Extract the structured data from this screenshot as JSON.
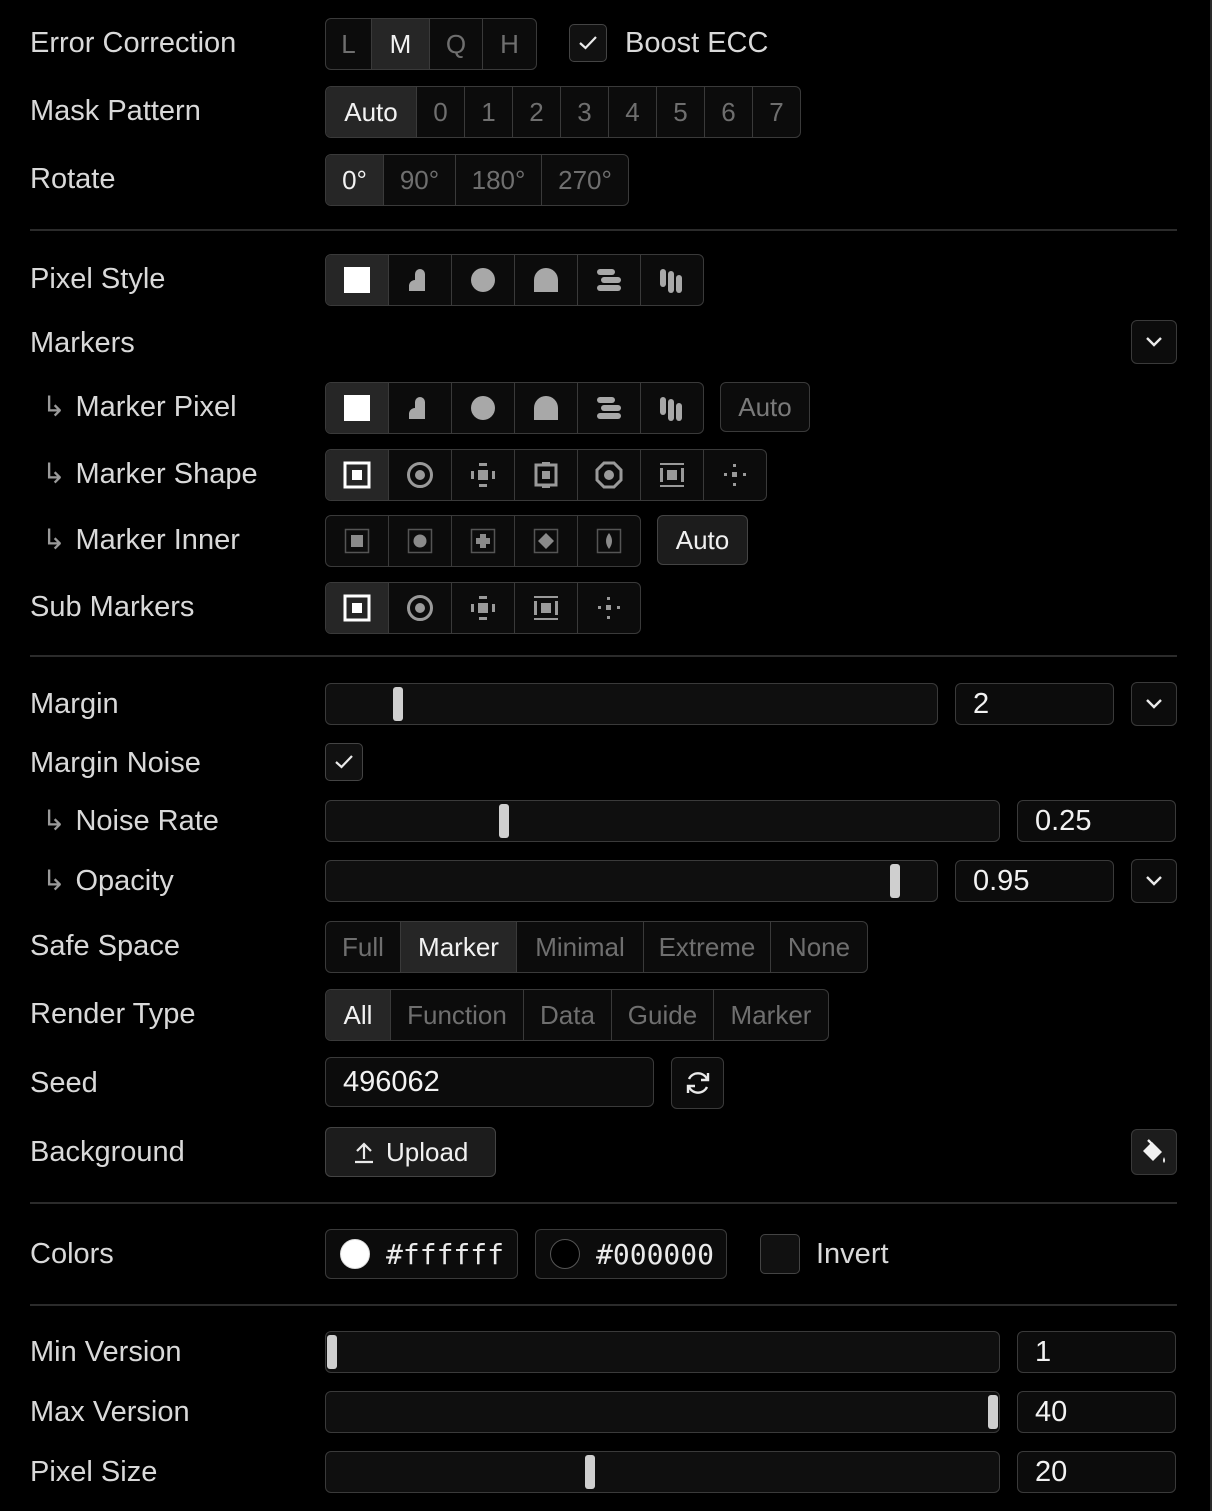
{
  "error_correction": {
    "label": "Error Correction",
    "options": [
      "L",
      "M",
      "Q",
      "H"
    ],
    "selected": "M",
    "boost_ecc": {
      "label": "Boost ECC",
      "checked": true
    }
  },
  "mask_pattern": {
    "label": "Mask Pattern",
    "options": [
      "Auto",
      "0",
      "1",
      "2",
      "3",
      "4",
      "5",
      "6",
      "7"
    ],
    "selected": "Auto"
  },
  "rotate": {
    "label": "Rotate",
    "options": [
      "0°",
      "90°",
      "180°",
      "270°"
    ],
    "selected": "0°"
  },
  "pixel_style": {
    "label": "Pixel Style",
    "options": [
      "square-icon",
      "dot-square-icon",
      "circle-icon",
      "rounded-icon",
      "rows-icon",
      "columns-icon"
    ],
    "selected": 0
  },
  "markers": {
    "label": "Markers",
    "marker_pixel": {
      "label": "Marker Pixel",
      "options": [
        "square-icon",
        "dot-square-icon",
        "circle-icon",
        "rounded-icon",
        "rows-icon",
        "columns-icon"
      ],
      "selected": 0,
      "auto_label": "Auto",
      "auto_active": false
    },
    "marker_shape": {
      "label": "Marker Shape",
      "options": [
        "box-marker-icon",
        "circle-marker-icon",
        "plus-marker-icon",
        "box-plus-marker-icon",
        "octagon-marker-icon",
        "tiny-plus-marker-icon",
        "random-marker-icon"
      ],
      "selected": 0
    },
    "marker_inner": {
      "label": "Marker Inner",
      "options": [
        "inner-square-icon",
        "inner-circle-icon",
        "inner-plus-icon",
        "inner-diamond-icon",
        "inner-eye-icon"
      ],
      "selected": null,
      "auto_label": "Auto",
      "auto_active": true
    }
  },
  "sub_markers": {
    "label": "Sub Markers",
    "options": [
      "box-marker-icon",
      "circle-marker-icon",
      "plus-marker-icon",
      "tiny-plus-marker-icon",
      "random-marker-icon"
    ],
    "selected": 0
  },
  "margin": {
    "label": "Margin",
    "value": "2",
    "min": 0,
    "max": 20,
    "fraction": 0.11
  },
  "margin_noise": {
    "label": "Margin Noise",
    "checked": true
  },
  "noise_rate": {
    "label": "Noise Rate",
    "value": "0.25",
    "fraction": 0.26
  },
  "opacity": {
    "label": "Opacity",
    "value": "0.95",
    "fraction": 0.94
  },
  "safe_space": {
    "label": "Safe Space",
    "options": [
      "Full",
      "Marker",
      "Minimal",
      "Extreme",
      "None"
    ],
    "selected": "Marker"
  },
  "render_type": {
    "label": "Render Type",
    "options": [
      "All",
      "Function",
      "Data",
      "Guide",
      "Marker"
    ],
    "selected": "All"
  },
  "seed": {
    "label": "Seed",
    "value": "496062"
  },
  "background": {
    "label": "Background",
    "upload_label": "Upload"
  },
  "colors": {
    "label": "Colors",
    "light": "#ffffff",
    "dark": "#000000",
    "invert": {
      "label": "Invert",
      "checked": false
    }
  },
  "min_version": {
    "label": "Min Version",
    "value": "1",
    "fraction": 0.0
  },
  "max_version": {
    "label": "Max Version",
    "value": "40",
    "fraction": 1.0
  },
  "pixel_size": {
    "label": "Pixel Size",
    "value": "20",
    "fraction": 0.39
  }
}
